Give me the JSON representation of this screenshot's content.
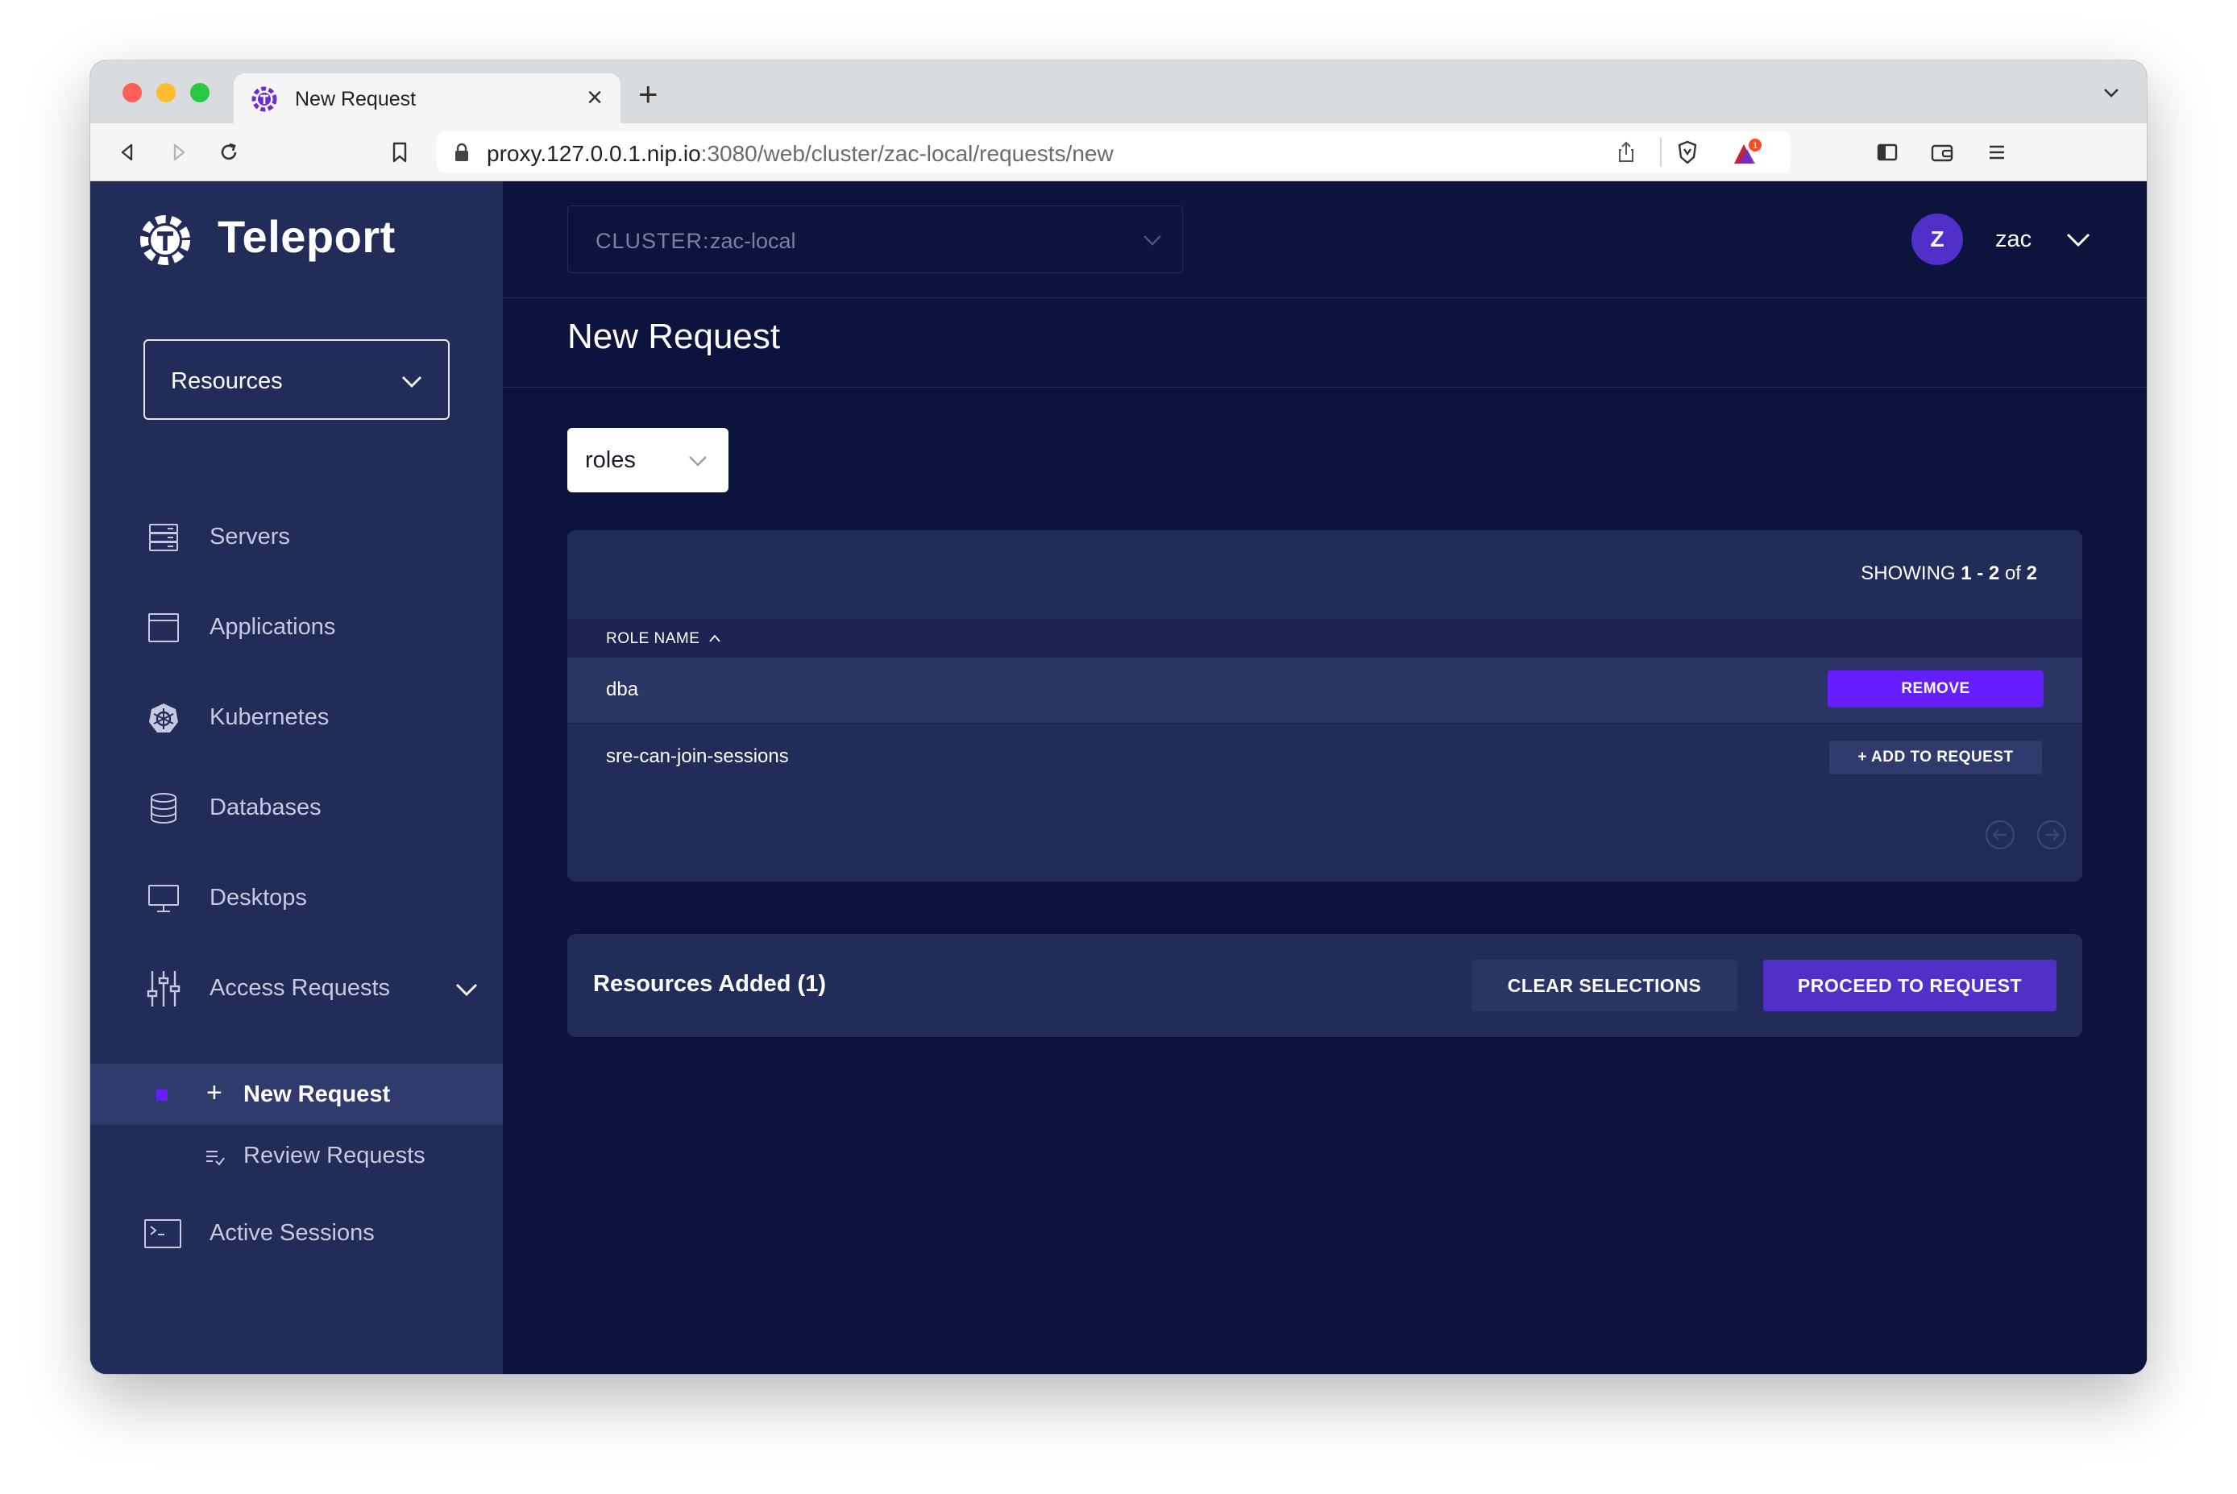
{
  "browser": {
    "tab_title": "New Request",
    "tab_close": "×",
    "new_tab": "+",
    "url_host": "proxy.127.0.0.1.nip.io",
    "url_path": ":3080/web/cluster/zac-local/requests/new",
    "shields_badge": "1"
  },
  "sidebar": {
    "brand": "Teleport",
    "resource_selector": "Resources",
    "items": [
      {
        "label": "Servers",
        "icon": "server-icon"
      },
      {
        "label": "Applications",
        "icon": "application-icon"
      },
      {
        "label": "Kubernetes",
        "icon": "kubernetes-icon"
      },
      {
        "label": "Databases",
        "icon": "database-icon"
      },
      {
        "label": "Desktops",
        "icon": "desktop-icon"
      },
      {
        "label": "Access Requests",
        "icon": "sliders-icon"
      }
    ],
    "sub_items": [
      {
        "label": "New Request",
        "prefix": "+",
        "active": true
      },
      {
        "label": "Review Requests",
        "icon": "list-check-icon"
      }
    ],
    "active_sessions": {
      "label": "Active Sessions",
      "icon": "terminal-icon"
    }
  },
  "topbar": {
    "cluster_key": "CLUSTER:",
    "cluster_value": "zac-local",
    "avatar_letter": "Z",
    "username": "zac"
  },
  "page": {
    "title": "New Request",
    "kind_select": "roles"
  },
  "table": {
    "showing_prefix": "SHOWING ",
    "showing_range": "1 - 2",
    "showing_of": " of ",
    "showing_total": "2",
    "column_header": "ROLE NAME",
    "rows": [
      {
        "name": "dba",
        "action": "REMOVE"
      },
      {
        "name": "sre-can-join-sessions",
        "action": "+ ADD TO REQUEST"
      }
    ]
  },
  "added": {
    "label": "Resources Added (1)",
    "clear_label": "CLEAR SELECTIONS",
    "proceed_label": "PROCEED TO REQUEST"
  },
  "colors": {
    "sidebar_bg": "#222c59",
    "main_bg": "#0c133d",
    "accent": "#651fff",
    "primary_button": "#512fc9"
  }
}
